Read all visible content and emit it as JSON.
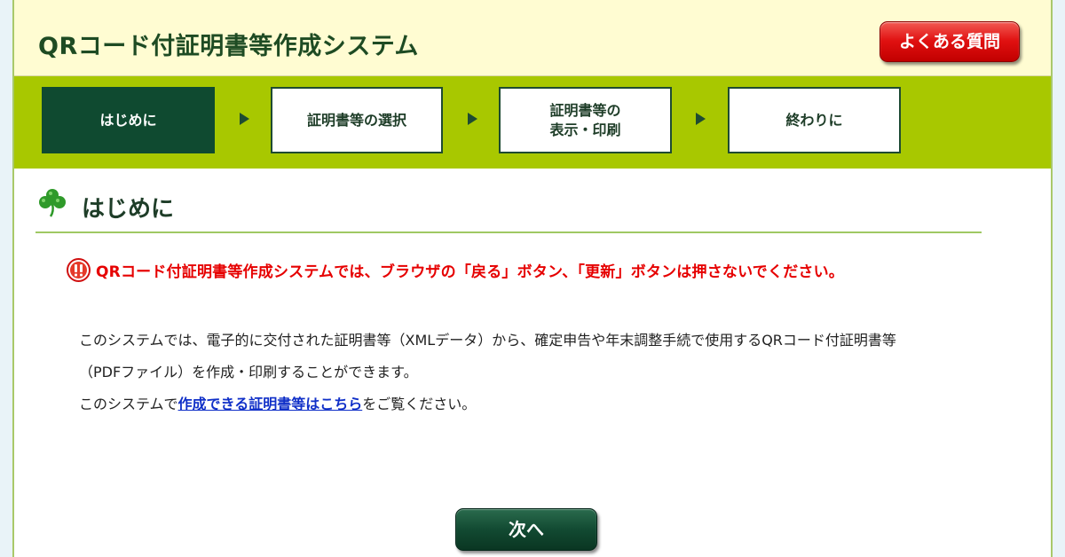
{
  "header": {
    "title": "QRコード付証明書等作成システム",
    "faq_label": "よくある質問"
  },
  "steps": [
    {
      "label": "はじめに",
      "active": true
    },
    {
      "label": "証明書等の選択",
      "active": false
    },
    {
      "label_line1": "証明書等の",
      "label_line2": "表示・印刷",
      "active": false
    },
    {
      "label": "終わりに",
      "active": false
    }
  ],
  "section": {
    "title": "はじめに",
    "icon": "clover-icon"
  },
  "warning": {
    "icon": "warning-icon",
    "text": "QRコード付証明書等作成システムでは、ブラウザの「戻る」ボタン、「更新」ボタンは押さないでください。"
  },
  "body": {
    "line1": "このシステムでは、電子的に交付された証明書等（XMLデータ）から、確定申告や年末調整手続で使用するQRコード付証明書等",
    "line2": "（PDFファイル）を作成・印刷することができます。",
    "line3_prefix": "このシステムで",
    "line3_link": "作成できる証明書等はこちら",
    "line3_suffix": "をご覧ください。"
  },
  "footer": {
    "next_label": "次へ"
  },
  "colors": {
    "title_green": "#1e4b23",
    "stepbar_green": "#a8c800",
    "active_step": "#0f4a30",
    "warning_red": "#e60000",
    "link_blue": "#1030c8"
  }
}
